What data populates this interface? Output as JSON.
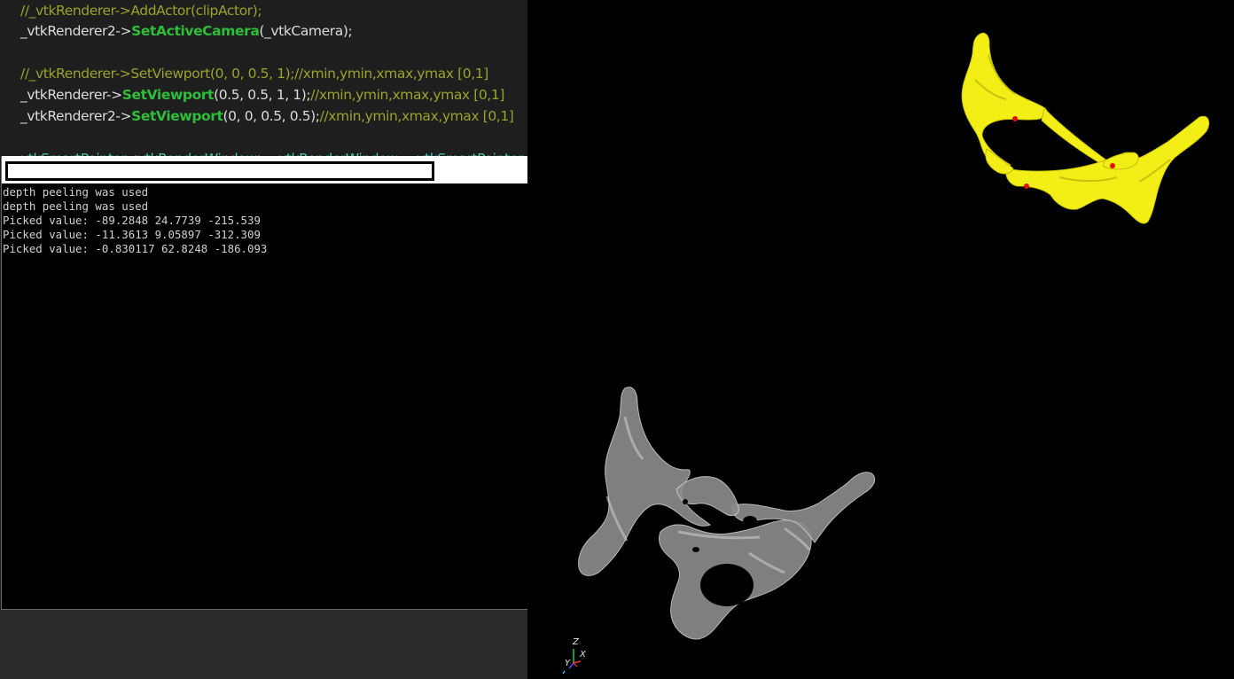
{
  "editor": {
    "lines": [
      {
        "parts": [
          {
            "cls": "c-comment",
            "text": "//_vtkRenderer->AddActor(clipActor);"
          }
        ]
      },
      {
        "parts": [
          {
            "cls": "c-plain",
            "text": "_vtkRenderer2->"
          },
          {
            "cls": "c-fn",
            "text": "SetActiveCamera"
          },
          {
            "cls": "c-plain",
            "text": "(_vtkCamera);"
          }
        ]
      },
      {
        "parts": []
      },
      {
        "parts": [
          {
            "cls": "c-comment",
            "text": "//_vtkRenderer->SetViewport(0, 0, 0.5, 1);//xmin,ymin,xmax,ymax  [0,1]"
          }
        ]
      },
      {
        "parts": [
          {
            "cls": "c-plain",
            "text": "_vtkRenderer->"
          },
          {
            "cls": "c-fn",
            "text": "SetViewport"
          },
          {
            "cls": "c-plain",
            "text": "(0.5, 0.5, 1, 1);"
          },
          {
            "cls": "c-comment",
            "text": "//xmin,ymin,xmax,ymax  [0,1]"
          }
        ]
      },
      {
        "parts": [
          {
            "cls": "c-plain",
            "text": "_vtkRenderer2->"
          },
          {
            "cls": "c-fn",
            "text": "SetViewport"
          },
          {
            "cls": "c-plain",
            "text": "(0, 0, 0.5, 0.5);"
          },
          {
            "cls": "c-comment",
            "text": "//xmin,ymin,xmax,ymax [0,1]"
          }
        ]
      },
      {
        "parts": []
      },
      {
        "parts": [
          {
            "cls": "c-teal",
            "text": "vtkSmartPointer<vtkRenderWindow> _vtkRenderWindow = vtkSmartPointer"
          }
        ]
      }
    ]
  },
  "console": {
    "title": "",
    "output": [
      "depth peeling was used",
      "depth peeling was used",
      "Picked value: -89.2848 24.7739 -215.539",
      "Picked value: -11.3613 9.05897 -312.309",
      "Picked value: -0.830117 62.8248 -186.093"
    ]
  },
  "viewport": {
    "axes": {
      "z": "Z",
      "x": "X",
      "y": "Y"
    },
    "colors": {
      "top_model": "#f2ee16",
      "top_model_shadow": "#b7b20a",
      "bottom_model": "#8a8a8a",
      "bottom_model_light": "#c9c9c9",
      "picked_points": "#e01010",
      "background": "#000000"
    }
  }
}
